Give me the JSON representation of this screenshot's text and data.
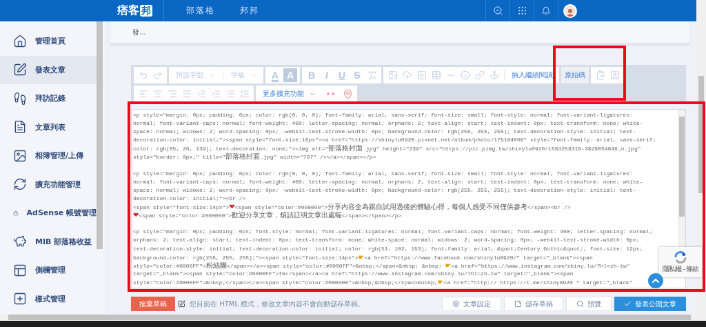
{
  "topbar": {
    "logo": {
      "text": "痞客",
      "badge": "邦"
    },
    "nav": [
      {
        "label": "部落格"
      },
      {
        "label": "邦邦"
      }
    ]
  },
  "sidebar": {
    "items": [
      {
        "label": "管理首頁",
        "selected": false
      },
      {
        "label": "發表文章",
        "selected": true
      },
      {
        "label": "拜訪記錄",
        "selected": false
      },
      {
        "label": "文章列表",
        "selected": false
      },
      {
        "label": "相簿管理/上傳",
        "selected": false
      },
      {
        "label": "擴充功能管理",
        "selected": false
      },
      {
        "label": "AdSense 帳號管理",
        "selected": false
      },
      {
        "label": "MIB 部落格收益",
        "selected": false
      },
      {
        "label": "側欄管理",
        "selected": false
      },
      {
        "label": "樣式管理",
        "selected": false
      }
    ]
  },
  "title_field": {
    "value": "發..."
  },
  "toolbar": {
    "font": "預設字型",
    "size": "字級",
    "format_buttons": [
      "A",
      "A",
      "B",
      "I",
      "U",
      "S"
    ],
    "insert_more": "插入繼續閱讀",
    "source": {
      "label": "原始碼",
      "selected": true
    },
    "more": "更多擴充功能"
  },
  "code_paragraphs": [
    [
      "<p style=\"margin: 0px; padding: 0px; color: rgb(0, 0, 0); font-family: arial, sans-serif; font-size: small; font-style: normal; font-variant-ligatures:",
      "normal; font-variant-caps: normal; font-weight: 400; letter-spacing: normal; orphans: 2; text-align: start; text-indent: 0px; text-transform: none; white-",
      "space: normal; widows: 2; word-spacing: 0px; -webkit-text-stroke-width: 0px; background-color: rgb(255, 255, 255); text-decoration-style: initial; text-",
      "decoration-color: initial;\"><span style=\"font-size:18px\"><a href=\"https://shinylu0920.pixnet.net/album/photo/175184806\" style=\"font-family: arial, sans-serif;",
      "color: rgb(85, 26, 139); text-decoration: none;\"><img alt=\"部落格封面.jpg\" height=\"239\" src=\"https://pic.pimg.tw/shinylu0920/1583258318-3829054648_n.jpg\"",
      "style=\"border: 0px;\" title=\"部落格封面.jpg\" width=\"767\" /></a></span></p>"
    ],
    [
      "<p style=\"margin: 0px; padding: 0px; color: rgb(0, 0, 0); font-family: arial, sans-serif; font-size: small; font-style: normal; font-variant-ligatures:",
      "normal; font-variant-caps: normal; font-weight: 400; letter-spacing: normal; orphans: 2; text-align: start; text-indent: 0px; text-transform: none; white-",
      "space: normal; widows: 2; word-spacing: 0px; -webkit-text-stroke-width: 0px; background-color: rgb(255, 255, 255); text-decoration-style: initial; text-",
      "decoration-color: initial;\"><br />",
      "<span style=\"font-size:14px\">❤<span style=\"color:#000000\">分享內容全為親自試用過後的體驗心得，每個人感受不同僅供參考</span><br />",
      "❤<span style=\"color:#000000\">歡迎分享文章，煩請註明文章出處喔</span></span></p>"
    ],
    [
      "<p style=\"margin: 0px; padding: 0px; font-style: normal; font-variant-ligatures: normal; font-variant-caps: normal; font-weight: 400; letter-spacing: normal;",
      "orphans: 2; text-align: start; text-indent: 0px; text-transform: none; white-space: normal; widows: 2; word-spacing: 0px; -webkit-text-stroke-width: 0px;",
      "text-decoration-style: initial; text-decoration-color: initial; color: rgb(51, 102, 153); font-family: arial, &quot;Century Gothic&quot;; font-size: 12px;",
      "background-color: rgb(255, 255, 255);\"><span style=\"font-size:14px\">☛<a href=\"https://www.facebook.com/shinylu0920/\" target=\"_blank\"><span",
      "style=\"color:#0000FF\">粉絲團</span></a><span style=\"color:#0000FF\">&nbsp;</span>&nbsp; &nbsp; ☛<a href=\"https://www.instagram.com/shiny.lu/?hl=zh-tw\"",
      "target=\"_blank\"><span style=\"color:#0000FF\">IG</span></a><a href=\"https://www.instagram.com/shiny.lu/?hl=zh-tw\" target=\"_blank\"><span",
      "style=\"color:#0000FF\">&nbsp;</span></a><span style=\"color:#000000\">&nbsp;&nbsp;</span>&nbsp;☛<a href=\"http:// https://t.me/shiny0920 \" target=\"_blank\""
    ]
  ],
  "recaptcha": {
    "text": "隱私權 - 條款"
  },
  "footer": {
    "discard": "捨棄草稿",
    "notice": "您目前在 HTML 模式，修改文章內容不會自動儲存草稿。",
    "buttons": [
      {
        "label": "文章設定",
        "kind": "outline"
      },
      {
        "label": "儲存草稿",
        "kind": "outline"
      },
      {
        "label": "預覽",
        "kind": "outline"
      },
      {
        "label": "發表公開文章",
        "kind": "primary"
      }
    ]
  }
}
